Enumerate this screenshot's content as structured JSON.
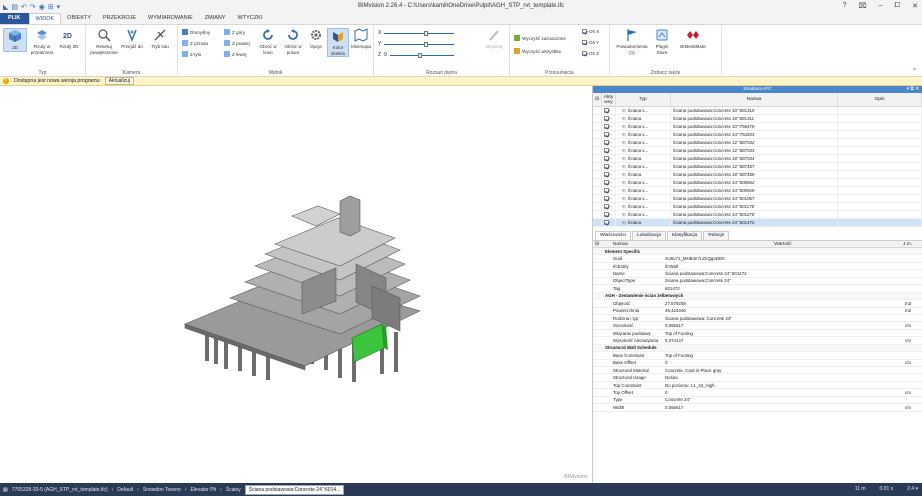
{
  "app": {
    "title": "BIMvision 2.26.4 - C:\\Users\\kamil\\OneDrive\\Pulpit\\AGH_STP_rvt_template.ifc",
    "window_controls": [
      "?",
      "⌧",
      "–",
      "⧠",
      "✕"
    ]
  },
  "tabs": [
    "PLIK",
    "WIDOK",
    "OBIEKTY",
    "PRZEKROJE",
    "WYMIAROWANIE",
    "ZMIANY",
    "WTYCZKI"
  ],
  "active_tab": "WIDOK",
  "ribbon": {
    "typ": {
      "label": "Typ",
      "btn_3d": "3D",
      "btn_rzuty": "Rzuty w przestrzeni",
      "btn_rzuty2d": "Rzuty 2D"
    },
    "kamera": {
      "label": "Kamera",
      "btn_resetuj": "Resetuj powiększenie",
      "btn_przejdz": "Przejdź do",
      "btn_tryb": "Tryb lotu"
    },
    "widok": {
      "label": "Widok",
      "domyslny": "Domyślny",
      "z_gory": "Z góry",
      "z_przodu": "Z przodu",
      "z_prawej": "Z prawej",
      "z_tylu": "Z tyłu",
      "z_lewej": "Z lewej",
      "obroc_lewo": "Obróć w lewo",
      "obroc_prawo": "Obróć w prawo",
      "opcje": "Opcje",
      "kolor": "Kolor obiektu",
      "minimapa": "Minimapa"
    },
    "rozsun": {
      "label": "Rozsuń piętra",
      "x": "X",
      "y": "Y",
      "z": "Z",
      "z_value": "0",
      "wyzeruj": "Wyzeruj"
    },
    "przesuniecia": {
      "label": "Przesunięcia",
      "wyczysc_zaznaczone": "Wyczyść zaznaczone",
      "wyczysc_wszystkie": "Wyczyść wszystkie",
      "os_x": "Oś X",
      "os_y": "Oś Y",
      "os_z": "Oś Z"
    },
    "zobacz": {
      "label": "Zobacz także",
      "powiadomienia": "Powiadomienia (1)",
      "plugin_store": "Plugin Store",
      "bimestimate": "BIMestiMate"
    }
  },
  "notification": {
    "text": "Dostępna jest nowa wersja programu",
    "button": "Aktualizuj"
  },
  "viewport": {
    "brand": "BIMvision"
  },
  "structure": {
    "title": "Struktura IFC",
    "controls": "▾ ⧉ ✕",
    "col_active": "Akty wny",
    "col_type": "Typ",
    "col_name": "Nazwa",
    "col_desc": "Opis",
    "rows": [
      {
        "type": "Ściana s...",
        "name": "Ściana podstawowa:Concrete 10\":691310"
      },
      {
        "type": "Ściana",
        "name": "Ściana podstawowa:Concrete 18\":691311"
      },
      {
        "type": "Ściana s...",
        "name": "Ściana podstawowa:Concrete 10\":759479"
      },
      {
        "type": "Ściana s...",
        "name": "Ściana podstawowa:Concrete 24\":764203"
      },
      {
        "type": "Ściana s...",
        "name": "Ściana podstawowa:Concrete 12\":587032"
      },
      {
        "type": "Ściana s...",
        "name": "Ściana podstawowa:Concrete 12\":587033"
      },
      {
        "type": "Ściana",
        "name": "Ściana podstawowa:Concrete 18\":587034"
      },
      {
        "type": "Ściana s...",
        "name": "Ściana podstawowa:Concrete 12\":587487"
      },
      {
        "type": "Ściana",
        "name": "Ściana podstawowa:Concrete 18\":587489"
      },
      {
        "type": "Ściana s...",
        "name": "Ściana podstawowa:Concrete 24\":600852"
      },
      {
        "type": "Ściana s...",
        "name": "Ściana podstawowa:Concrete 24\":600929"
      },
      {
        "type": "Ściana s...",
        "name": "Ściana podstawowa:Concrete 24\":601057"
      },
      {
        "type": "Ściana s...",
        "name": "Ściana podstawowa:Concrete 24\":601178"
      },
      {
        "type": "Ściana s...",
        "name": "Ściana podstawowa:Concrete 24\":601278"
      },
      {
        "type": "Ściana",
        "name": "Ściana podstawowa:Concrete 24\":601472"
      }
    ]
  },
  "properties": {
    "tabs": [
      "Właściwości",
      "Lokalizacja",
      "Klasyfikacja",
      "Relacje"
    ],
    "col_name": "Nazwa",
    "col_value": "Wartość",
    "col_unit": "J.m.",
    "rows": [
      {
        "cat": true,
        "name": "Element Specific"
      },
      {
        "name": "Guid",
        "value": "3U6u71_MHB4e7LZnQgeDBX",
        "unit": ""
      },
      {
        "name": "IfcEntity",
        "value": "IfcWall",
        "unit": ""
      },
      {
        "name": "Name",
        "value": "Ściana podstawowa:Concrete 24\":601472",
        "unit": ""
      },
      {
        "name": "ObjectType",
        "value": "Ściana podstawowa:Concrete 24\"",
        "unit": ""
      },
      {
        "name": "Tag",
        "value": "601472",
        "unit": ""
      },
      {
        "cat": true,
        "name": "AGH - Zestawienie ścian żelbetowych"
      },
      {
        "name": "Objętość",
        "value": "27,579208",
        "unit": "m3"
      },
      {
        "name": "Powierzchnia",
        "value": "45,424346",
        "unit": "m2"
      },
      {
        "name": "Rodzina i typ",
        "value": "Ściana podstawowa: Concrete 24\"",
        "unit": ""
      },
      {
        "name": "Szerokość",
        "value": "0,065617",
        "unit": "cm"
      },
      {
        "name": "Wiązanie podstawy",
        "value": "Top of Footing",
        "unit": ""
      },
      {
        "name": "Wysokość niezwiązana",
        "value": "0,374147",
        "unit": "cm"
      },
      {
        "cat": true,
        "name": "Structural Wall Schedule"
      },
      {
        "name": "Base Constraint",
        "value": "Top of Footing",
        "unit": ""
      },
      {
        "name": "Base Offset",
        "value": "0",
        "unit": "cm"
      },
      {
        "name": "Structural Material",
        "value": "Concrete, Cast-in-Place gray",
        "unit": ""
      },
      {
        "name": "Structural Usage",
        "value": "Nośna",
        "unit": ""
      },
      {
        "name": "Top Constraint",
        "value": "Do poziomu: L1_43_High",
        "unit": ""
      },
      {
        "name": "Top Offset",
        "value": "0",
        "unit": "cm"
      },
      {
        "name": "Type",
        "value": "Concrete 24\"",
        "unit": ""
      },
      {
        "name": "Width",
        "value": "0,065617",
        "unit": "cm"
      }
    ]
  },
  "statusbar": {
    "file": "7765328-33-5 (AGH_STP_rvt_template.ifc)",
    "items": [
      "Default",
      "Snowdon Towers",
      "Elevator Pit",
      "Ściany"
    ],
    "selected": "Ściana podstawowa:Concrete 24\":6014...",
    "right": [
      "11 m",
      "0.01 s",
      "2.4 ▾"
    ]
  }
}
